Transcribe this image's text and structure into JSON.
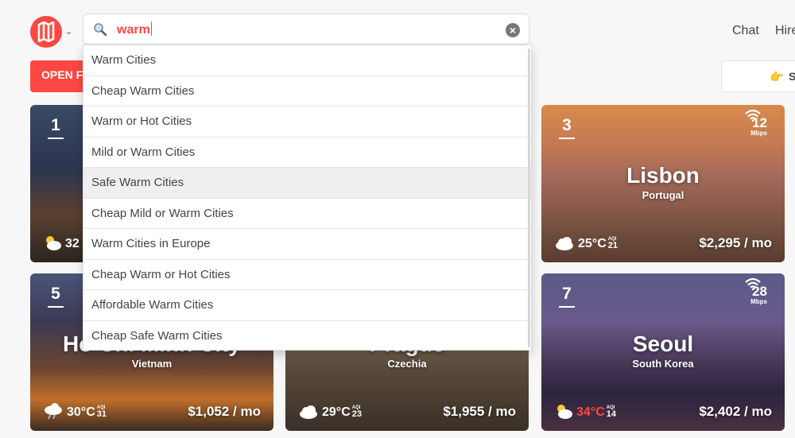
{
  "header": {
    "search_value": "warm",
    "nav": [
      "Chat",
      "Hire"
    ]
  },
  "buttons": {
    "open_filters": "OPEN FILTERS",
    "right_partial": "S"
  },
  "suggestions": [
    "Warm Cities",
    "Cheap Warm Cities",
    "Warm or Hot Cities",
    "Mild or Warm Cities",
    "Safe Warm Cities",
    "Cheap Mild or Warm Cities",
    "Warm Cities in Europe",
    "Cheap Warm or Hot Cities",
    "Affordable Warm Cities",
    "Cheap Safe Warm Cities"
  ],
  "highlighted_suggestion": "Safe Warm Cities",
  "cards": [
    {
      "rank": "1",
      "city": "",
      "country": "",
      "temp": "32",
      "aqi": "",
      "cost": "",
      "wifi": "",
      "weather_icon": "sun-cloud-icon"
    },
    {
      "rank": "3",
      "city": "Lisbon",
      "country": "Portugal",
      "temp": "25°C",
      "aqi": "21",
      "cost": "$2,295 / mo",
      "wifi": "12",
      "wifi_unit": "Mbps",
      "weather_icon": "cloud-icon"
    },
    {
      "rank": "5",
      "city": "Ho Chi Minh City",
      "country": "Vietnam",
      "temp": "30°C",
      "aqi": "31",
      "cost": "$1,052 / mo",
      "wifi": "",
      "weather_icon": "rain-cloud-icon"
    },
    {
      "rank": "",
      "city": "Prague",
      "country": "Czechia",
      "temp": "29°C",
      "aqi": "23",
      "cost": "$1,955 / mo",
      "wifi": "",
      "weather_icon": "cloud-icon"
    },
    {
      "rank": "7",
      "city": "Seoul",
      "country": "South Korea",
      "temp": "34°C",
      "aqi": "14",
      "cost": "$2,402 / mo",
      "wifi": "28",
      "wifi_unit": "Mbps",
      "weather_icon": "sun-cloud-icon"
    }
  ],
  "aqi_label": "AQI",
  "colors": {
    "brand": "#ff4742",
    "hot_temp": "#ff4742"
  }
}
